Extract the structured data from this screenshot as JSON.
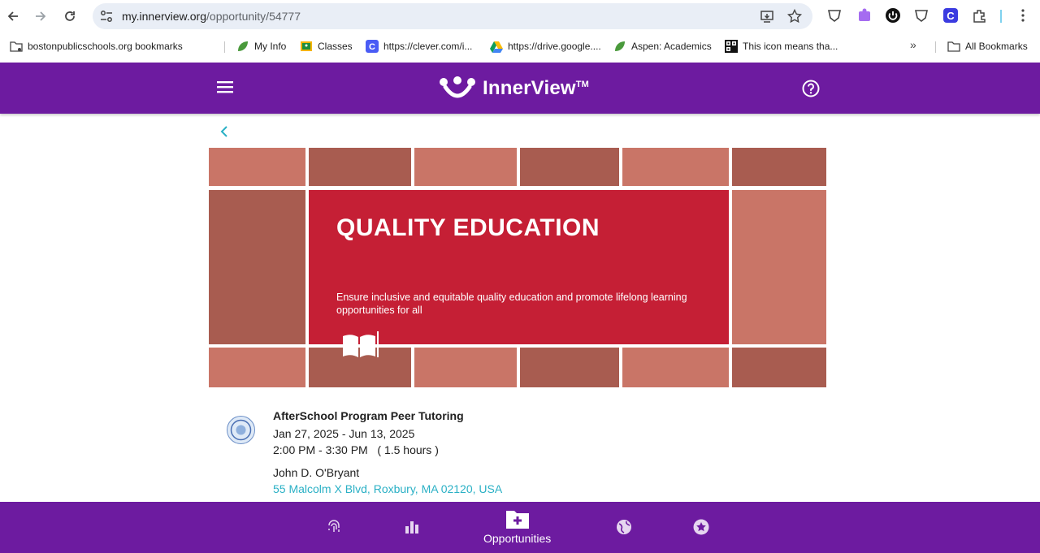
{
  "browser": {
    "url_host": "my.innerview.org",
    "url_path": "/opportunity/54777"
  },
  "bookmarks": [
    {
      "label": "bostonpublicschools.org bookmarks"
    },
    {
      "label": "My Info"
    },
    {
      "label": "Classes"
    },
    {
      "label": "https://clever.com/i..."
    },
    {
      "label": "https://drive.google...."
    },
    {
      "label": "Aspen: Academics"
    },
    {
      "label": "This icon means tha..."
    },
    {
      "label": "All Bookmarks"
    }
  ],
  "header": {
    "logo_text": "InnerView",
    "logo_tm": "TM"
  },
  "banner": {
    "title": "QUALITY EDUCATION",
    "subtitle": "Ensure inclusive and equitable quality education and promote lifelong learning opportunities for all"
  },
  "opportunity": {
    "title": "AfterSchool Program Peer Tutoring",
    "dates": "Jan 27, 2025 - Jun 13, 2025",
    "time": "2:00 PM - 3:30 PM   ( 1.5 hours )",
    "place": "John D. O'Bryant",
    "address": "55 Malcolm X Blvd, Roxbury, MA 02120, USA"
  },
  "bottom_nav": {
    "active_label": "Opportunities"
  },
  "colors": {
    "brand_purple": "#6d1ba0",
    "banner_red": "#c51f35",
    "link_teal": "#2ab0c5"
  }
}
